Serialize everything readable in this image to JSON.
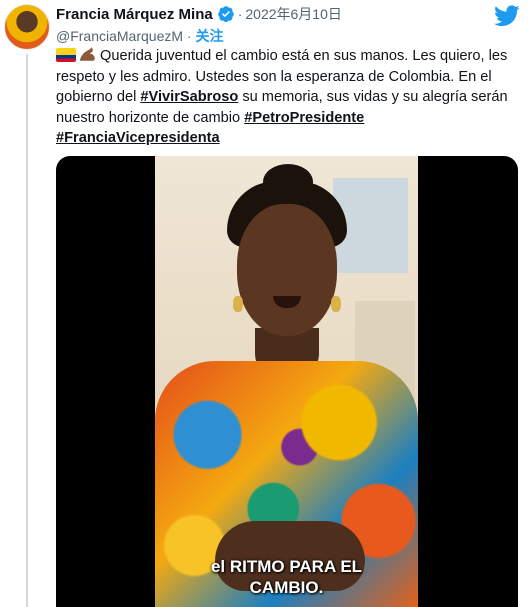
{
  "user": {
    "name": "Francia Márquez Mina",
    "handle": "@FranciaMarquezM",
    "follow_label": "关注",
    "separator": "·"
  },
  "tweet": {
    "date": "2022年6月10日",
    "segments": [
      {
        "type": "text",
        "value": " Querida juventud el cambio está en sus manos. Les quiero, les respeto y les admiro. Ustedes son la esperanza de Colombia. En el gobierno del "
      },
      {
        "type": "hashtag",
        "value": "#VivirSabroso"
      },
      {
        "type": "text",
        "value": " su memoria, sus vidas y su alegría serán nuestro horizonte de cambio "
      },
      {
        "type": "hashtag",
        "value": "#PetroPresidente"
      },
      {
        "type": "hashtag",
        "value": "#FranciaVicepresidenta"
      }
    ],
    "emojis": [
      "colombia-flag",
      "flexed-biceps-medium-dark-skin"
    ]
  },
  "video": {
    "subtitle_line1": "el RITMO PARA EL",
    "subtitle_line2": "CAMBIO."
  },
  "colors": {
    "accent": "#1d9bf0",
    "text": "#0f1419",
    "secondary": "#536471",
    "thread_line": "#cfd9de"
  },
  "icons": [
    "verified-badge-icon",
    "twitter-bird-icon"
  ]
}
